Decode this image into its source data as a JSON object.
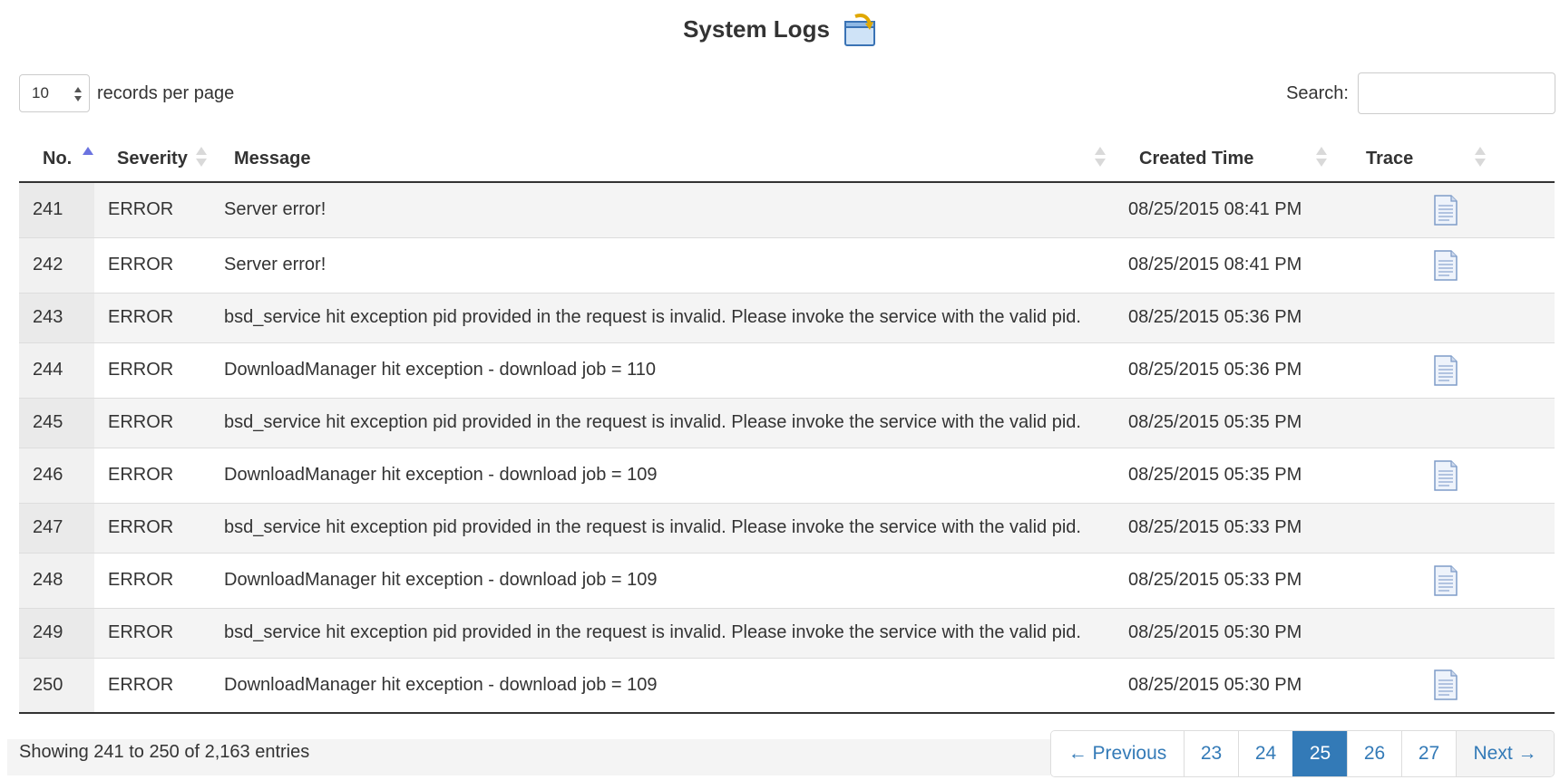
{
  "page": {
    "title": "System Logs",
    "title_icon": "folder-arrow-icon"
  },
  "controls": {
    "length_value": "10",
    "length_suffix": "records per page",
    "search_label": "Search:",
    "search_value": "",
    "search_placeholder": ""
  },
  "table": {
    "headers": {
      "no": "No.",
      "severity": "Severity",
      "message": "Message",
      "created": "Created Time",
      "trace": "Trace"
    },
    "sorted_column": "no",
    "sort_direction": "ascending",
    "rows": [
      {
        "no": "241",
        "severity": "ERROR",
        "message": "Server error!",
        "created": "08/25/2015 08:41 PM",
        "has_trace": true
      },
      {
        "no": "242",
        "severity": "ERROR",
        "message": "Server error!",
        "created": "08/25/2015 08:41 PM",
        "has_trace": true
      },
      {
        "no": "243",
        "severity": "ERROR",
        "message": "bsd_service hit exception pid provided in the request is invalid. Please invoke the service with the valid pid.",
        "created": "08/25/2015 05:36 PM",
        "has_trace": false
      },
      {
        "no": "244",
        "severity": "ERROR",
        "message": "DownloadManager hit exception - download job = 110",
        "created": "08/25/2015 05:36 PM",
        "has_trace": true
      },
      {
        "no": "245",
        "severity": "ERROR",
        "message": "bsd_service hit exception pid provided in the request is invalid. Please invoke the service with the valid pid.",
        "created": "08/25/2015 05:35 PM",
        "has_trace": false
      },
      {
        "no": "246",
        "severity": "ERROR",
        "message": "DownloadManager hit exception - download job = 109",
        "created": "08/25/2015 05:35 PM",
        "has_trace": true
      },
      {
        "no": "247",
        "severity": "ERROR",
        "message": "bsd_service hit exception pid provided in the request is invalid. Please invoke the service with the valid pid.",
        "created": "08/25/2015 05:33 PM",
        "has_trace": false
      },
      {
        "no": "248",
        "severity": "ERROR",
        "message": "DownloadManager hit exception - download job = 109",
        "created": "08/25/2015 05:33 PM",
        "has_trace": true
      },
      {
        "no": "249",
        "severity": "ERROR",
        "message": "bsd_service hit exception pid provided in the request is invalid. Please invoke the service with the valid pid.",
        "created": "08/25/2015 05:30 PM",
        "has_trace": false
      },
      {
        "no": "250",
        "severity": "ERROR",
        "message": "DownloadManager hit exception - download job = 109",
        "created": "08/25/2015 05:30 PM",
        "has_trace": true
      }
    ]
  },
  "footer": {
    "info": "Showing 241 to 250 of 2,163 entries",
    "pagination": {
      "previous": "← Previous",
      "pages": [
        "23",
        "24",
        "25",
        "26",
        "27"
      ],
      "current": "25",
      "next": "Next →"
    }
  },
  "colors": {
    "accent": "#337ab7",
    "sort_active": "#6b73e0",
    "sort_inactive": "#d9d9d9"
  }
}
